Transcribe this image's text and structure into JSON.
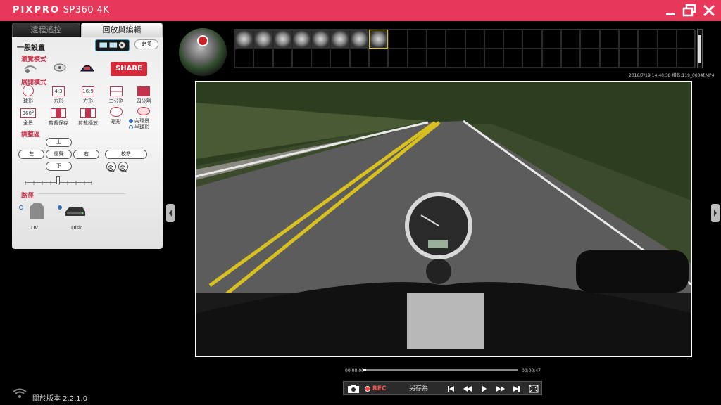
{
  "app": {
    "brand": "PIXPRO",
    "model": "SP360 4K"
  },
  "tabs": {
    "remote": "遠程遙控",
    "playback": "回放與編輯"
  },
  "panel": {
    "general_settings": "一般設置",
    "more": "更多",
    "browse_mode": "瀏覽模式",
    "share": "SHARE",
    "expand_mode": "展開模式",
    "layouts": [
      {
        "icon": "sphere-icon",
        "label": "球形"
      },
      {
        "icon": "4-3-icon",
        "glyph": "4:3",
        "label": "方形"
      },
      {
        "icon": "16-9-icon",
        "glyph": "16:9",
        "label": "方形"
      },
      {
        "icon": "split-2-icon",
        "label": "二分割"
      },
      {
        "icon": "split-4-icon",
        "label": "四分割"
      },
      {
        "icon": "360-icon",
        "glyph": "360°",
        "label": "全景"
      },
      {
        "icon": "clip-save-icon",
        "label": "剪裁保存"
      },
      {
        "icon": "clip-play-icon",
        "label": "剪裁播放"
      },
      {
        "icon": "ring-icon",
        "label": "環形"
      }
    ],
    "options": [
      {
        "label": "內環景",
        "selected": true
      },
      {
        "label": "半球形",
        "selected": false
      }
    ],
    "adjust": "調整區",
    "up": "上",
    "left": "左",
    "reset": "復歸",
    "right": "右",
    "down": "下",
    "level": "校準",
    "zoom_level": 0.5,
    "path": "路徑",
    "path_options": [
      {
        "label": "DV",
        "selected": false
      },
      {
        "label": "Disk",
        "selected": true
      }
    ]
  },
  "status": {
    "version": "關於版本 2.2.1.0"
  },
  "thumbnails": {
    "filled_count": 8,
    "selected_index": 7,
    "total_cells": 48
  },
  "file_info": "2016/7/19 14:40:38 檔名:119_0004f.MP4",
  "player": {
    "current_time": "00:00:00",
    "total_time": "00:00:47",
    "progress": 0,
    "rec": "REC",
    "save_as": "另存為"
  },
  "colors": {
    "titlebar": "#e8385a",
    "accent": "#c2334b",
    "share": "#d42a3a"
  }
}
